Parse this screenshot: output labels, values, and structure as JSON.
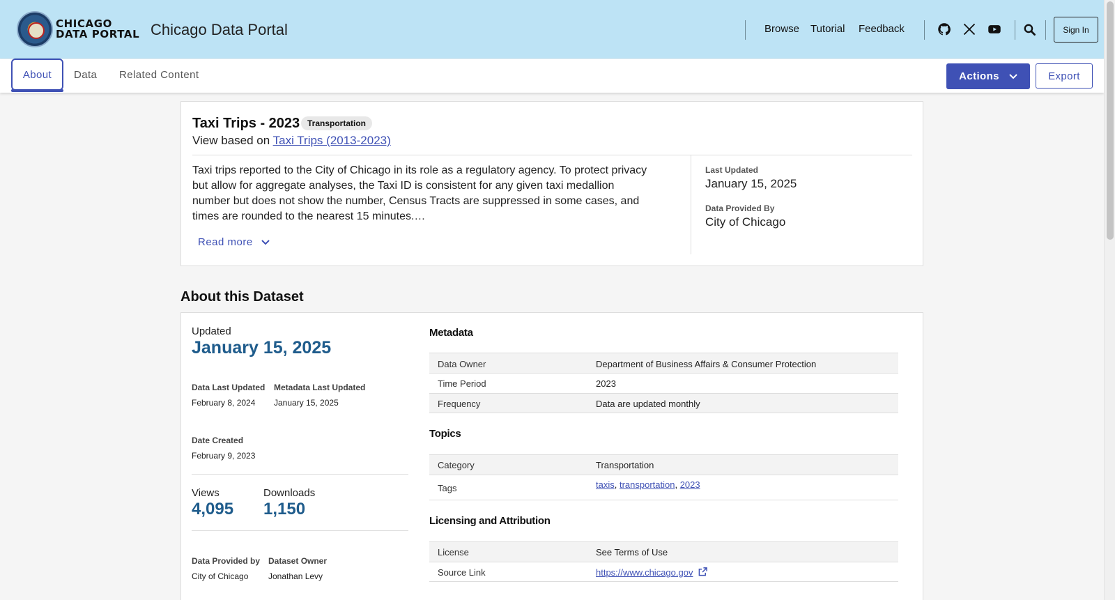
{
  "header": {
    "logo_line1": "CHICAGO",
    "logo_line2": "DATA PORTAL",
    "site_title": "Chicago Data Portal",
    "nav": [
      "Browse",
      "Tutorial",
      "Feedback"
    ],
    "social_icons": [
      "github-icon",
      "x-twitter-icon",
      "youtube-icon"
    ],
    "search_icon": "search-icon",
    "sign_in": "Sign In"
  },
  "tabs": {
    "about": "About",
    "data": "Data",
    "related": "Related Content",
    "actions": "Actions",
    "export": "Export"
  },
  "summary": {
    "title": "Taxi Trips - 2023",
    "badge": "Transportation",
    "based_prefix": "View based on ",
    "based_link": "Taxi Trips (2013-2023)",
    "description": "Taxi trips reported to the City of Chicago in its role as a regulatory agency. To protect privacy but allow for aggregate analyses, the Taxi ID is consistent for any given taxi medallion number but does not show the number, Census Tracts are suppressed in some cases, and times are rounded to the nearest 15 minutes.…",
    "read_more": "Read more",
    "last_updated_label": "Last Updated",
    "last_updated": "January 15, 2025",
    "provided_by_label": "Data Provided By",
    "provided_by": "City of Chicago"
  },
  "about": {
    "heading": "About this Dataset",
    "updated_label": "Updated",
    "updated": "January 15, 2025",
    "data_last_updated_label": "Data Last Updated",
    "data_last_updated": "February 8, 2024",
    "metadata_last_updated_label": "Metadata Last Updated",
    "metadata_last_updated": "January 15, 2025",
    "date_created_label": "Date Created",
    "date_created": "February 9, 2023",
    "views_label": "Views",
    "views": "4,095",
    "downloads_label": "Downloads",
    "downloads": "1,150",
    "provided_by_label": "Data Provided by",
    "provided_by": "City of Chicago",
    "owner_label": "Dataset Owner",
    "owner": "Jonathan Levy"
  },
  "metadata": {
    "heading": "Metadata",
    "rows": [
      {
        "key": "Data Owner",
        "value": "Department of Business Affairs & Consumer Protection"
      },
      {
        "key": "Time Period",
        "value": "2023"
      },
      {
        "key": "Frequency",
        "value": "Data are updated monthly"
      }
    ]
  },
  "topics": {
    "heading": "Topics",
    "category_label": "Category",
    "category": "Transportation",
    "tags_label": "Tags",
    "tags": [
      "taxis",
      "transportation",
      "2023"
    ]
  },
  "licensing": {
    "heading": "Licensing and Attribution",
    "license_label": "License",
    "license": "See Terms of Use",
    "source_label": "Source Link",
    "source": "https://www.chicago.gov"
  },
  "colors": {
    "header_bg": "#bde3f5",
    "accent": "#3f51b5",
    "stat_blue": "#1f5c8c"
  }
}
